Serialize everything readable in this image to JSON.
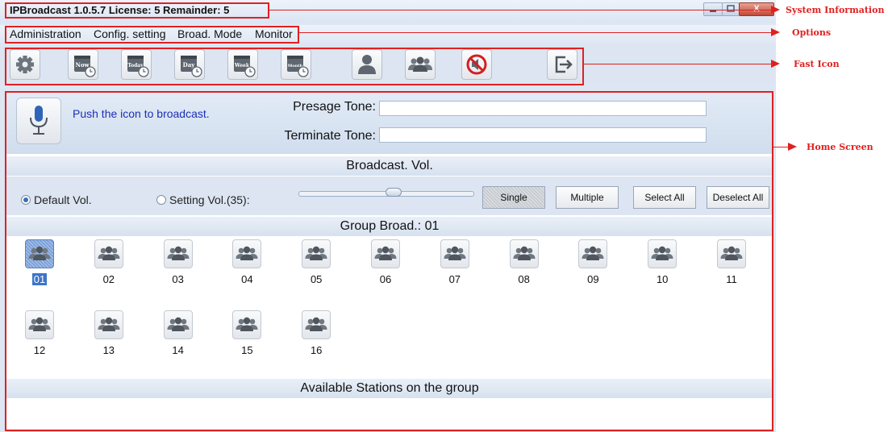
{
  "window": {
    "title": "IPBroadcast 1.0.5.7 License: 5 Remainder: 5",
    "close_glyph": "X"
  },
  "menu": [
    "Administration",
    "Config. setting",
    "Broad. Mode",
    "Monitor"
  ],
  "toolbar": {
    "icons": [
      "gear-icon",
      "now-clock-icon",
      "today-clock-icon",
      "day-clock-icon",
      "week-clock-icon",
      "month-clock-icon",
      "person-icon",
      "group-icon",
      "mute-icon",
      "exit-icon"
    ],
    "now_label": "Now",
    "today_label": "Today",
    "day_label": "Day",
    "week_label": "Week",
    "month_label": "Month"
  },
  "broadcast": {
    "push_text": "Push the icon to broadcast.",
    "presage_label": "Presage Tone:",
    "presage_value": "",
    "terminate_label": "Terminate Tone:",
    "terminate_value": ""
  },
  "volume": {
    "header": "Broadcast. Vol.",
    "default_label": "Default Vol.",
    "setting_label": "Setting Vol.(35):",
    "selected": "default",
    "level": 35,
    "buttons": {
      "single": "Single",
      "multiple": "Multiple",
      "select_all": "Select All",
      "deselect_all": "Deselect All"
    }
  },
  "groups": {
    "header": "Group Broad.: 01",
    "selected": "01",
    "items": [
      "01",
      "02",
      "03",
      "04",
      "05",
      "06",
      "07",
      "08",
      "09",
      "10",
      "11",
      "12",
      "13",
      "14",
      "15",
      "16"
    ]
  },
  "stations": {
    "header": "Available Stations on the group"
  },
  "annotations": {
    "system_information": "System Information",
    "options": "Options",
    "fast_icon": "Fast Icon",
    "home_screen": "Home Screen",
    "color": "#e02020"
  }
}
